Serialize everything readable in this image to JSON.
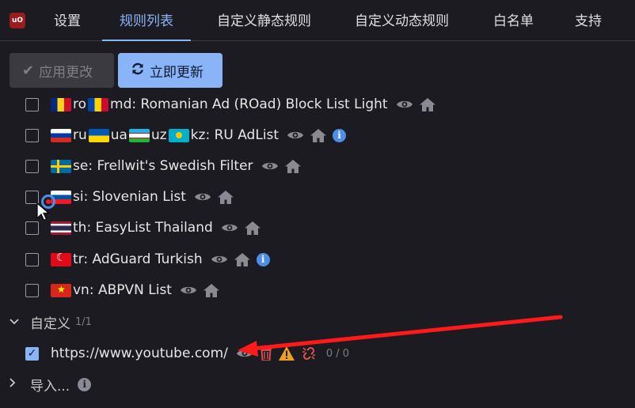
{
  "tabs": [
    "设置",
    "规则列表",
    "自定义静态规则",
    "自定义动态规则",
    "白名单",
    "支持"
  ],
  "logo_text": "uO",
  "actions": {
    "apply_label": "应用更改",
    "update_label": "立即更新"
  },
  "filters": [
    {
      "checked": false,
      "label_parts": [
        "ro",
        "md: Romanian Ad (ROad) Block List Light"
      ],
      "flags": [
        "ro",
        "md"
      ],
      "has_info": false
    },
    {
      "checked": false,
      "label_parts": [
        "ru",
        "ua",
        "uz",
        "kz: RU AdList"
      ],
      "flags": [
        "ru",
        "ua",
        "uz",
        "kz"
      ],
      "has_info": true
    },
    {
      "checked": false,
      "label_parts": [
        "se: Frellwit's Swedish Filter"
      ],
      "flags": [
        "se"
      ],
      "has_info": false
    },
    {
      "checked": false,
      "label_parts": [
        "si: Slovenian List"
      ],
      "flags": [
        "si"
      ],
      "has_info": false
    },
    {
      "checked": false,
      "label_parts": [
        "th: EasyList Thailand"
      ],
      "flags": [
        "th"
      ],
      "has_info": false
    },
    {
      "checked": false,
      "label_parts": [
        "tr: AdGuard Turkish"
      ],
      "flags": [
        "tr"
      ],
      "has_info": true
    },
    {
      "checked": false,
      "label_parts": [
        "vn: ABPVN List"
      ],
      "flags": [
        "vn"
      ],
      "has_info": false
    }
  ],
  "custom_section": {
    "title": "自定义",
    "count": "1/1"
  },
  "custom_entry": {
    "checked": true,
    "url": "https://www.youtube.com/",
    "stats": "0 / 0"
  },
  "import_section": {
    "title": "导入..."
  },
  "colors": {
    "accent": "#8ab4f8",
    "background": "#1c1b22",
    "info": "#4d8fe8",
    "warning": "#f0a020",
    "danger": "#e05050",
    "annotation_arrow": "#ff1a1a"
  }
}
